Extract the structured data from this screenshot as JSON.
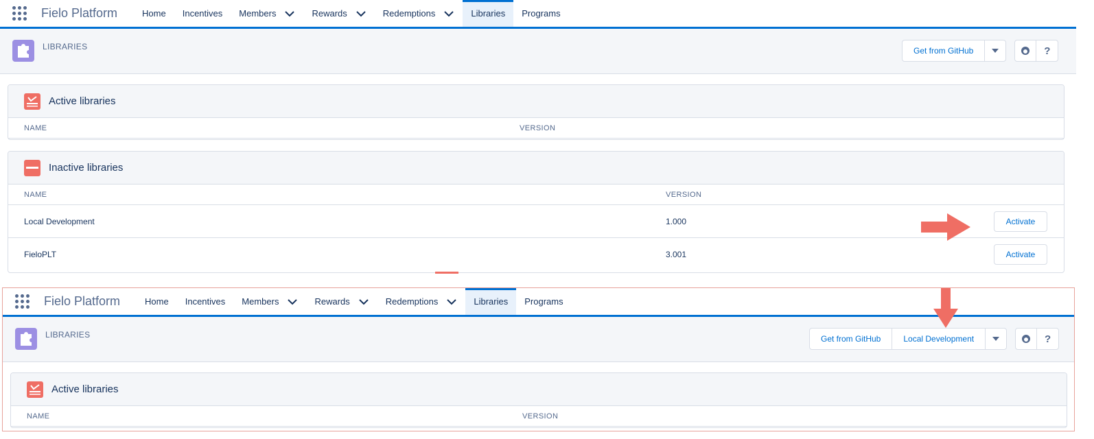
{
  "nav": {
    "app_name": "Fielo Platform",
    "items": [
      {
        "label": "Home",
        "has_menu": false
      },
      {
        "label": "Incentives",
        "has_menu": false
      },
      {
        "label": "Members",
        "has_menu": true
      },
      {
        "label": "Rewards",
        "has_menu": true
      },
      {
        "label": "Redemptions",
        "has_menu": true
      },
      {
        "label": "Libraries",
        "has_menu": false,
        "active": true
      },
      {
        "label": "Programs",
        "has_menu": false
      }
    ]
  },
  "top": {
    "page_title": "LIBRARIES",
    "header_buttons": {
      "get_github": "Get from GitHub"
    },
    "active_card": {
      "title": "Active libraries",
      "columns": {
        "name": "NAME",
        "version": "VERSION"
      }
    },
    "inactive_card": {
      "title": "Inactive libraries",
      "columns": {
        "name": "NAME",
        "version": "VERSION"
      },
      "rows": [
        {
          "name": "Local Development",
          "version": "1.000",
          "action": "Activate"
        },
        {
          "name": "FieloPLT",
          "version": "3.001",
          "action": "Activate"
        }
      ]
    }
  },
  "bottom": {
    "page_title": "LIBRARIES",
    "header_buttons": {
      "get_github": "Get from GitHub",
      "local_dev": "Local Development"
    },
    "active_card": {
      "title": "Active libraries",
      "columns": {
        "name": "NAME",
        "version": "VERSION"
      }
    }
  },
  "icons": {
    "help": "?",
    "colors": {
      "accent": "#0070d2",
      "card_icon": "#ef6e64",
      "page_icon": "#9c8fe3",
      "arrow": "#ef6e64"
    }
  }
}
